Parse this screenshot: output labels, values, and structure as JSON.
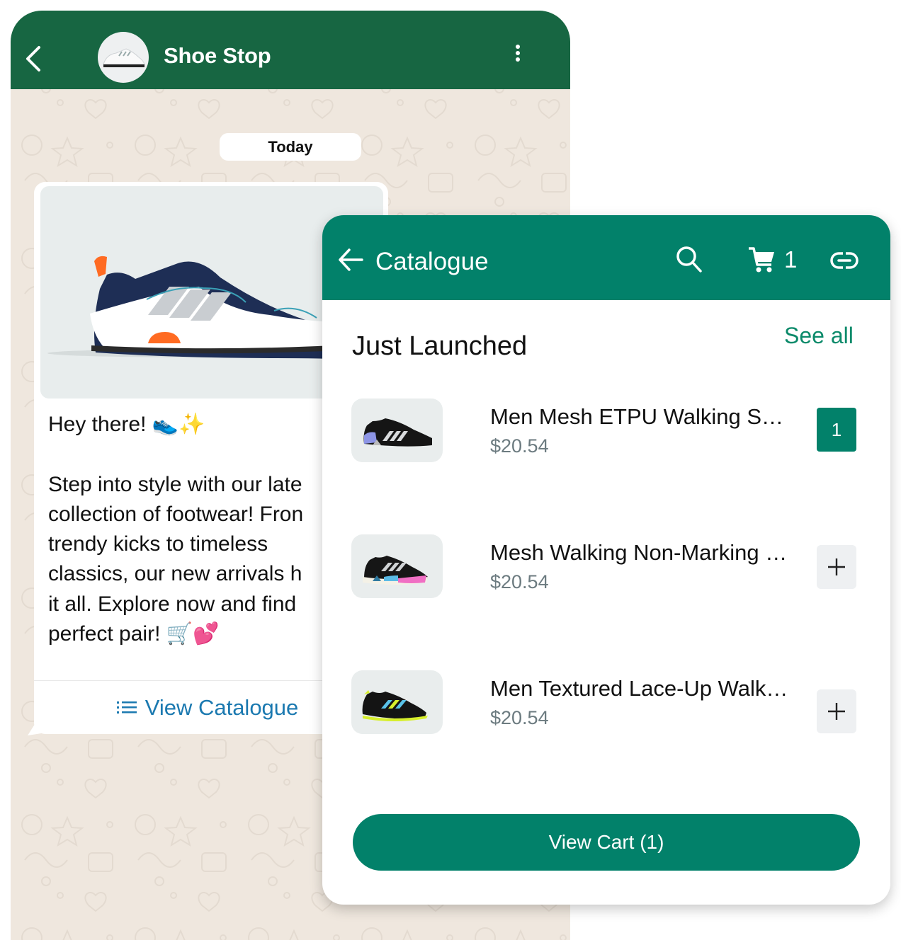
{
  "chat": {
    "contact_name": "Shoe Stop",
    "date_chip": "Today",
    "message": {
      "greeting": "Hey there! 👟✨",
      "body": "Step into style with our latest collection of footwear! From trendy kicks to timeless classics, our new arrivals have it all. Explore now and find the perfect pair! 🛒💕",
      "visible_lines": [
        "Hey there! 👟✨",
        "",
        "Step into style with our late",
        "collection of footwear! Fron",
        "trendy kicks to timeless",
        "classics, our new arrivals h",
        "it all. Explore now and find",
        "perfect pair! 🛒💕"
      ],
      "action_label": "View Catalogue",
      "action_icon": "list-icon"
    },
    "colors": {
      "header": "#176642",
      "wallpaper": "#efe7de",
      "link": "#1b79b0"
    }
  },
  "catalogue": {
    "title": "Catalogue",
    "header_icons": [
      "back-arrow-icon",
      "search-icon",
      "cart-icon",
      "link-icon"
    ],
    "cart_count": "1",
    "section_title": "Just Launched",
    "see_all_label": "See all",
    "items": [
      {
        "name": "Men Mesh ETPU Walking S…",
        "price": "$20.54",
        "quantity": "1",
        "in_cart": true
      },
      {
        "name": "Mesh Walking Non-Marking …",
        "price": "$20.54",
        "quantity": "+",
        "in_cart": false
      },
      {
        "name": "Men Textured Lace-Up Walk…",
        "price": "$20.54",
        "quantity": "+",
        "in_cart": false
      }
    ],
    "view_cart_label": "View Cart (1)",
    "colors": {
      "accent": "#02816a",
      "price": "#6c7b80"
    }
  }
}
